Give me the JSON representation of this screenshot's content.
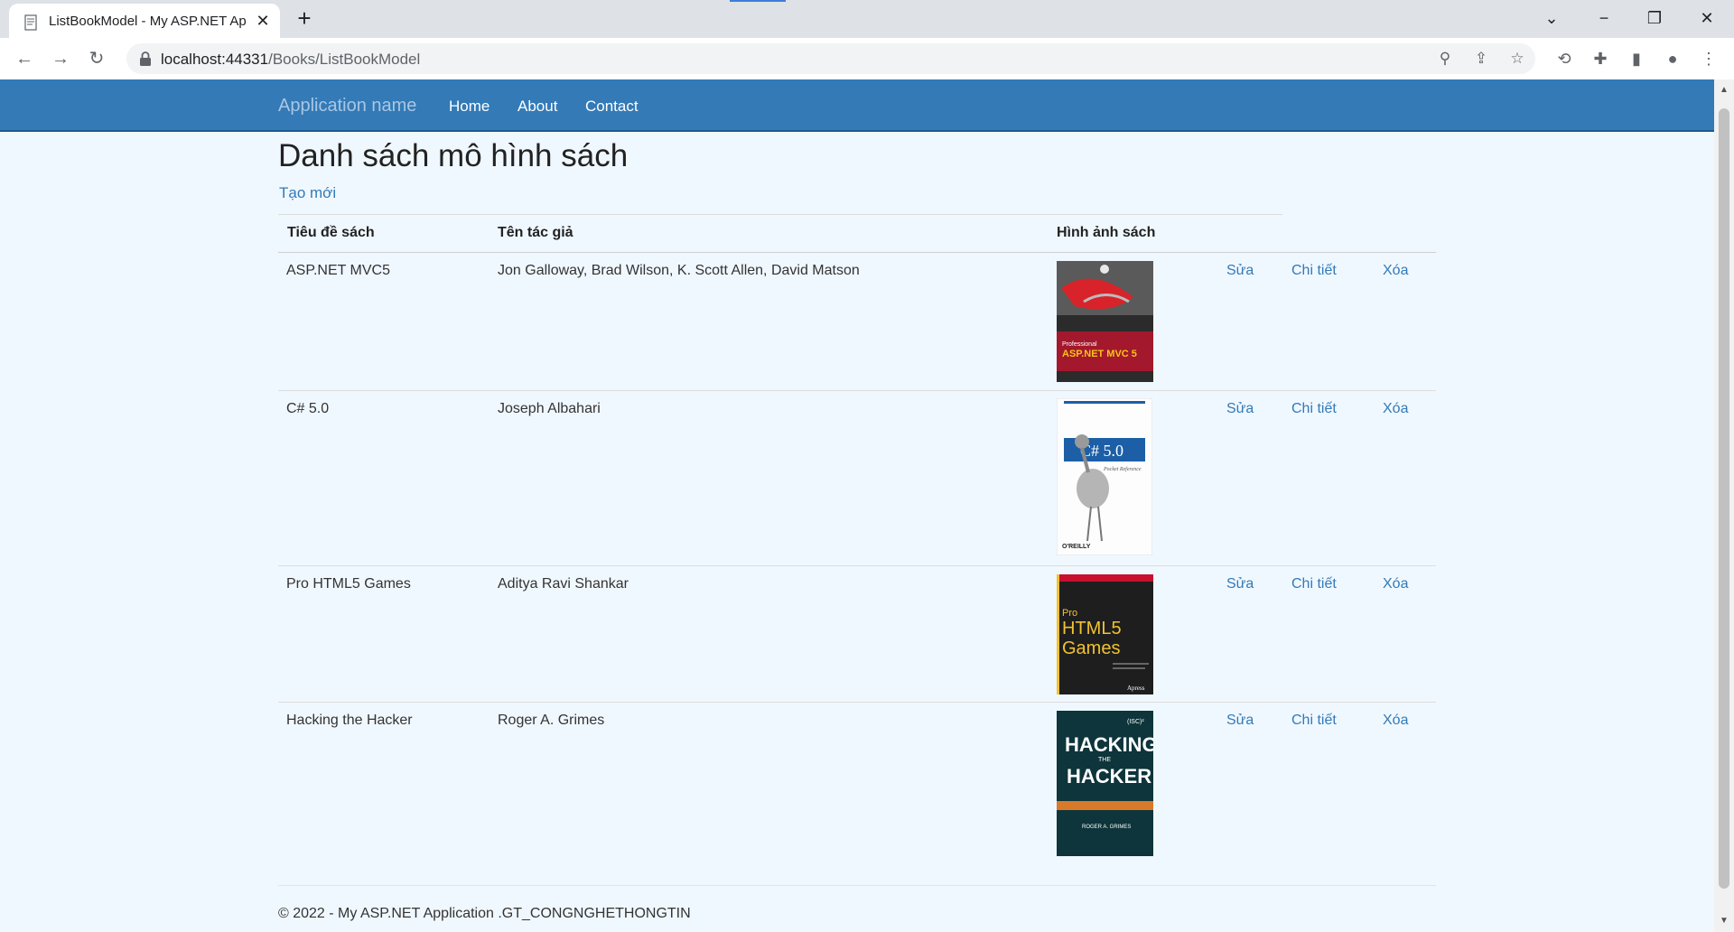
{
  "browser": {
    "tab_title": "ListBookModel - My ASP.NET Ap",
    "url_host": "localhost:44331",
    "url_path": "/Books/ListBookModel",
    "icons": [
      "back-icon",
      "forward-icon",
      "reload-icon",
      "lock-icon",
      "zoom-icon",
      "share-icon",
      "star-icon",
      "extension-sync-icon",
      "puzzle-icon",
      "side-panel-icon",
      "profile-icon",
      "more-icon"
    ]
  },
  "navbar": {
    "brand": "Application name",
    "links": [
      "Home",
      "About",
      "Contact"
    ],
    "color": "#337ab7"
  },
  "page": {
    "title": "Danh sách mô hình sách",
    "create_link": "Tạo mới"
  },
  "table": {
    "headers": [
      "Tiêu đề sách",
      "Tên tác giả",
      "Hình ảnh sách"
    ],
    "rows": [
      {
        "title": "ASP.NET MVC5",
        "author": "Jon Galloway, Brad Wilson, K. Scott Allen, David Matson",
        "cover_text": [
          "Professional",
          "ASP.NET MVC 5"
        ],
        "edit": "Sửa",
        "details": "Chi tiết",
        "delete": "Xóa"
      },
      {
        "title": "C# 5.0",
        "author": "Joseph Albahari",
        "cover_text": [
          "C# 5.0",
          "Pocket Reference",
          "O'REILLY"
        ],
        "edit": "Sửa",
        "details": "Chi tiết",
        "delete": "Xóa"
      },
      {
        "title": "Pro HTML5 Games",
        "author": "Aditya Ravi Shankar",
        "cover_text": [
          "Pro",
          "HTML5",
          "Games",
          "Apress"
        ],
        "edit": "Sửa",
        "details": "Chi tiết",
        "delete": "Xóa"
      },
      {
        "title": "Hacking the Hacker",
        "author": "Roger A. Grimes",
        "cover_text": [
          "(ISC)²",
          "HACKING",
          "THE",
          "HACKER",
          "ROGER A. GRIMES"
        ],
        "edit": "Sửa",
        "details": "Chi tiết",
        "delete": "Xóa"
      }
    ]
  },
  "footer": {
    "text": "© 2022 - My ASP.NET Application .GT_CONGNGHETHONGTIN"
  }
}
